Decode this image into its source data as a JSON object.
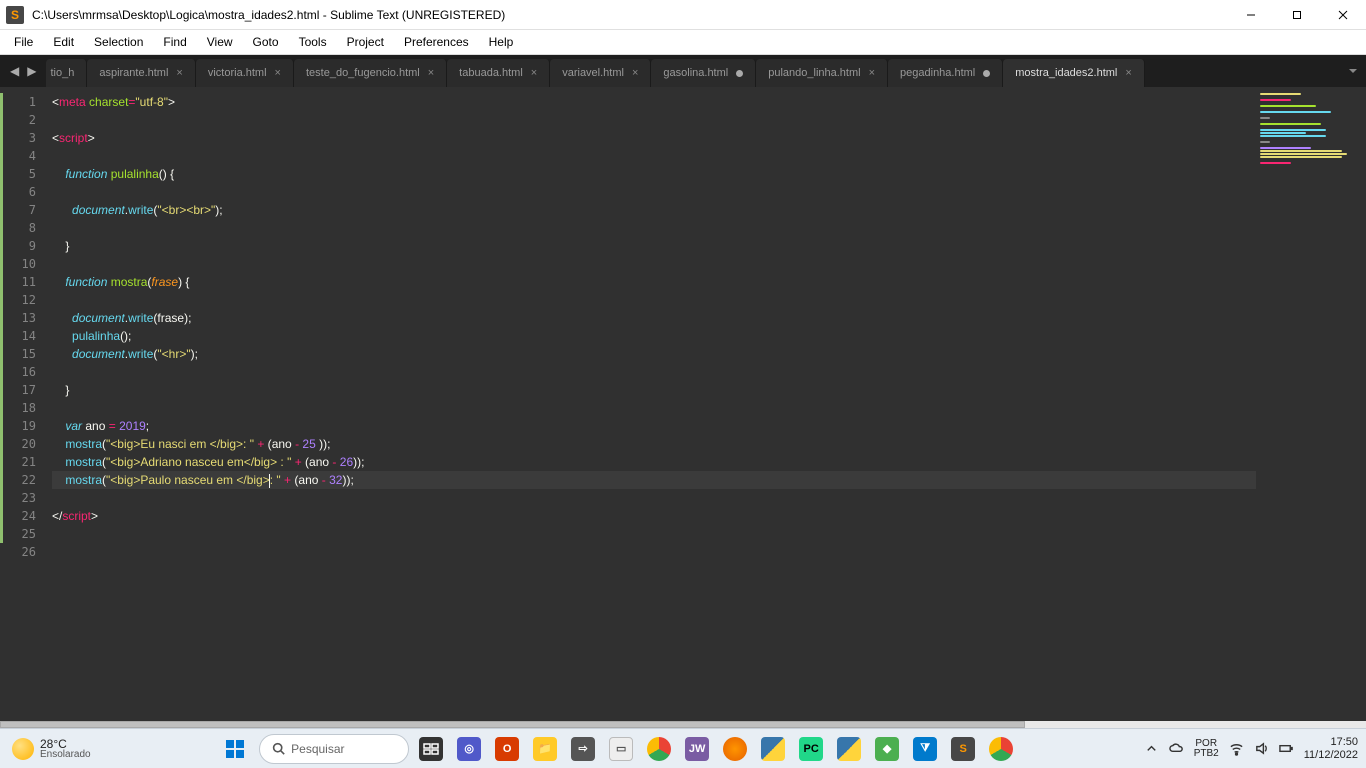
{
  "window": {
    "title": "C:\\Users\\mrmsa\\Desktop\\Logica\\mostra_idades2.html - Sublime Text (UNREGISTERED)"
  },
  "menu": {
    "items": [
      "File",
      "Edit",
      "Selection",
      "Find",
      "View",
      "Goto",
      "Tools",
      "Project",
      "Preferences",
      "Help"
    ]
  },
  "tabs": {
    "left_truncated": "tio_h",
    "items": [
      {
        "label": "aspirante.html",
        "dirty": false,
        "active": false
      },
      {
        "label": "victoria.html",
        "dirty": false,
        "active": false
      },
      {
        "label": "teste_do_fugencio.html",
        "dirty": false,
        "active": false
      },
      {
        "label": "tabuada.html",
        "dirty": false,
        "active": false
      },
      {
        "label": "variavel.html",
        "dirty": false,
        "active": false
      },
      {
        "label": "gasolina.html",
        "dirty": true,
        "active": false
      },
      {
        "label": "pulando_linha.html",
        "dirty": false,
        "active": false
      },
      {
        "label": "pegadinha.html",
        "dirty": true,
        "active": false
      },
      {
        "label": "mostra_idades2.html",
        "dirty": false,
        "active": true
      }
    ]
  },
  "editor": {
    "line_count": 26,
    "cursor_line": 22,
    "modified_lines": [
      1,
      2,
      3,
      4,
      5,
      6,
      7,
      8,
      9,
      10,
      11,
      12,
      13,
      14,
      15,
      16,
      17,
      18,
      19,
      20,
      21,
      22,
      23,
      24,
      25
    ],
    "code": {
      "l1": {
        "pre": "<",
        "tag": "meta",
        "sp": " ",
        "attr": "charset",
        "eq": "=",
        "str": "\"utf-8\"",
        "post": ">"
      },
      "l3": {
        "pre": "<",
        "tag": "script",
        "post": ">"
      },
      "l5": {
        "indent": "    ",
        "kw": "function",
        "sp": " ",
        "fn": "pulalinha",
        "paren": "() {"
      },
      "l7a": {
        "indent": "      ",
        "obj": "document",
        "dot": ".",
        "call": "write",
        "open": "(",
        "str": "\"<br><br>\"",
        "close": ");"
      },
      "l9": {
        "indent": "    ",
        "brace": "}"
      },
      "l11": {
        "indent": "    ",
        "kw": "function",
        "sp": " ",
        "fn": "mostra",
        "open": "(",
        "param": "frase",
        "close": ") {"
      },
      "l13": {
        "indent": "      ",
        "obj": "document",
        "dot": ".",
        "call": "write",
        "open": "(",
        "arg": "frase",
        "close": ");"
      },
      "l14": {
        "indent": "      ",
        "fn": "pulalinha",
        "rest": "();"
      },
      "l15": {
        "indent": "      ",
        "obj": "document",
        "dot": ".",
        "call": "write",
        "open": "(",
        "str": "\"<hr>\"",
        "close": ");"
      },
      "l17": {
        "indent": "    ",
        "brace": "}"
      },
      "l19": {
        "indent": "    ",
        "kw": "var",
        "sp": " ",
        "name": "ano",
        "sp2": " ",
        "op": "=",
        "sp3": " ",
        "num": "2019",
        "semi": ";"
      },
      "l20": {
        "indent": "    ",
        "fn": "mostra",
        "open": "(",
        "str": "\"<big>Eu nasci em </big>: \"",
        "sp": " ",
        "plus": "+",
        "sp2": " (",
        "var": "ano",
        "sp3": " ",
        "minus": "-",
        "sp4": " ",
        "num": "25",
        "tail": " ));"
      },
      "l21": {
        "indent": "    ",
        "fn": "mostra",
        "open": "(",
        "str": "\"<big>Adriano nasceu em</big> : \"",
        "sp": " ",
        "plus": "+",
        "sp2": " (",
        "var": "ano",
        "sp3": " ",
        "minus": "-",
        "sp4": " ",
        "num": "26",
        "tail": "));"
      },
      "l22": {
        "indent": "    ",
        "fn": "mostra",
        "open": "(",
        "str1": "\"<big>Paulo nasceu em </big>",
        "str2": ": \"",
        "sp": " ",
        "plus": "+",
        "sp2": " (",
        "var": "ano",
        "sp3": " ",
        "minus": "-",
        "sp4": " ",
        "num": "32",
        "tail": "));"
      },
      "l24": {
        "pre": "</",
        "tag": "script",
        "post": ">"
      }
    }
  },
  "taskbar": {
    "weather": {
      "temp": "28°C",
      "cond": "Ensolarado"
    },
    "search_placeholder": "Pesquisar",
    "lang": {
      "top": "POR",
      "bottom": "PTB2"
    },
    "clock": {
      "time": "17:50",
      "date": "11/12/2022"
    }
  }
}
